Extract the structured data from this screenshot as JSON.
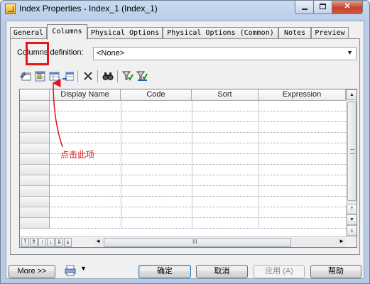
{
  "window": {
    "title": "Index Properties - Index_1 (Index_1)",
    "controls": {
      "minimize_icon": "minimize-icon",
      "maximize_icon": "maximize-icon",
      "close_glyph": "✕"
    }
  },
  "tabs": [
    {
      "label": "General"
    },
    {
      "label": "Columns",
      "active": true
    },
    {
      "label": "Physical Options"
    },
    {
      "label": "Physical Options (Common)"
    },
    {
      "label": "Notes"
    },
    {
      "label": "Preview"
    }
  ],
  "columns_definition": {
    "label": "Columns definition:",
    "value": "<None>"
  },
  "toolbar": {
    "icons": [
      "properties-icon",
      "add-columns-icon",
      "insert-row-icon",
      "append-row-icon",
      "delete-icon",
      "find-icon",
      "filter-icon",
      "clear-filter-icon"
    ]
  },
  "grid": {
    "headers": [
      "",
      "Display Name",
      "Code",
      "Sort",
      "Expression"
    ],
    "row_count": 12,
    "scroll_up_glyph": "▲",
    "scroll_down_glyph": "▼",
    "hscroll_left_glyph": "◄",
    "hscroll_right_glyph": "►",
    "hscroll_grip": "III"
  },
  "annotation": {
    "text": "点击此项",
    "color": "#e0141a"
  },
  "footer": {
    "more_label": "More >>",
    "ok_label": "确定",
    "cancel_label": "取消",
    "apply_label": "应用 (A)",
    "help_label": "帮助"
  },
  "colors": {
    "highlight": "#e8141b",
    "title_gradient": "#b9cde8",
    "close_button": "#c5432a"
  }
}
